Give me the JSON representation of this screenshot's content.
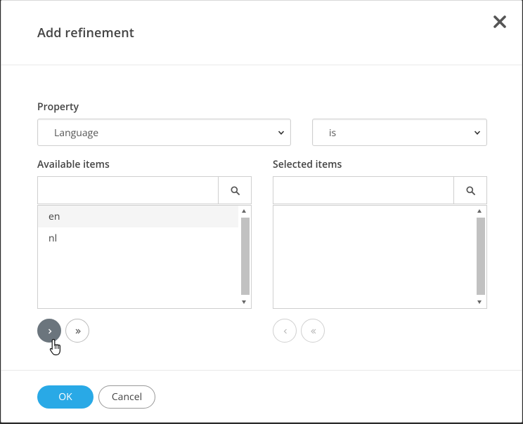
{
  "dialog": {
    "title": "Add refinement"
  },
  "property": {
    "label": "Property",
    "value": "Language",
    "operator_value": "is"
  },
  "available": {
    "label": "Available items",
    "search_placeholder": "",
    "items": [
      "en",
      "nl"
    ]
  },
  "selected": {
    "label": "Selected items",
    "search_placeholder": "",
    "items": []
  },
  "footer": {
    "ok_label": "OK",
    "cancel_label": "Cancel"
  },
  "colors": {
    "primary": "#29a9e6",
    "dark_button": "#6b757d",
    "border": "#cfcfcf"
  },
  "icons": {
    "close": "close-icon",
    "search": "search-icon",
    "move_right": "chevron-right-icon",
    "move_all_right": "double-chevron-right-icon",
    "move_left": "chevron-left-icon",
    "move_all_left": "double-chevron-left-icon"
  }
}
